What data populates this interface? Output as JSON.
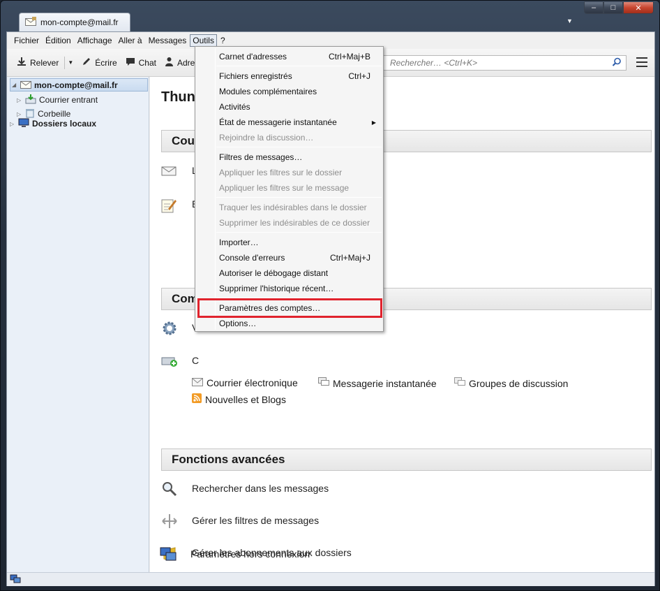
{
  "window": {
    "tab_title": "mon-compte@mail.fr",
    "controls": {
      "minimize": "–",
      "maximize": "□",
      "close": "✕"
    }
  },
  "menubar": {
    "items": [
      "Fichier",
      "Édition",
      "Affichage",
      "Aller à",
      "Messages",
      "Outils",
      "?"
    ],
    "active": "Outils"
  },
  "toolbar": {
    "get_mail": "Relever",
    "write": "Écrire",
    "chat": "Chat",
    "address": "Adres",
    "search_placeholder": "Rechercher… <Ctrl+K>"
  },
  "folders": {
    "account": "mon-compte@mail.fr",
    "inbox": "Courrier entrant",
    "trash": "Corbeille",
    "local": "Dossiers locaux"
  },
  "main": {
    "heading": "Thun",
    "section_mail": "Cour",
    "mail_item1": "L",
    "mail_item2": "É",
    "section_accounts": "Com",
    "acct_item1": "V",
    "acct_item2": "C",
    "acct_types": {
      "email": "Courrier électronique",
      "im": "Messagerie instantanée",
      "newsgroups": "Groupes de discussion",
      "feeds": "Nouvelles et Blogs"
    },
    "section_advanced": "Fonctions avancées",
    "advanced": [
      "Rechercher dans les messages",
      "Gérer les filtres de messages",
      "Gérer les abonnements aux dossiers",
      "Paramètres hors connexion"
    ]
  },
  "tools_menu": {
    "items": [
      {
        "label": "Carnet d'adresses",
        "shortcut": "Ctrl+Maj+B",
        "disabled": false
      },
      {
        "label": "Fichiers enregistrés",
        "shortcut": "Ctrl+J",
        "disabled": false
      },
      {
        "label": "Modules complémentaires",
        "shortcut": "",
        "disabled": false
      },
      {
        "label": "Activités",
        "shortcut": "",
        "disabled": false
      },
      {
        "label": "État de messagerie instantanée",
        "shortcut": "",
        "disabled": false,
        "submenu": true
      },
      {
        "label": "Rejoindre la discussion…",
        "shortcut": "",
        "disabled": true
      },
      {
        "label": "Filtres de messages…",
        "shortcut": "",
        "disabled": false
      },
      {
        "label": "Appliquer les filtres sur le dossier",
        "shortcut": "",
        "disabled": true
      },
      {
        "label": "Appliquer les filtres sur le message",
        "shortcut": "",
        "disabled": true
      },
      {
        "label": "Traquer les indésirables dans le dossier",
        "shortcut": "",
        "disabled": true
      },
      {
        "label": "Supprimer les indésirables de ce dossier",
        "shortcut": "",
        "disabled": true
      },
      {
        "label": "Importer…",
        "shortcut": "",
        "disabled": false
      },
      {
        "label": "Console d'erreurs",
        "shortcut": "Ctrl+Maj+J",
        "disabled": false
      },
      {
        "label": "Autoriser le débogage distant",
        "shortcut": "",
        "disabled": false
      },
      {
        "label": "Supprimer l'historique récent…",
        "shortcut": "",
        "disabled": false
      },
      {
        "label": "Paramètres des comptes…",
        "shortcut": "",
        "disabled": false,
        "highlighted": true
      },
      {
        "label": "Options…",
        "shortcut": "",
        "disabled": false
      }
    ],
    "highlight_color": "#e0232d"
  }
}
